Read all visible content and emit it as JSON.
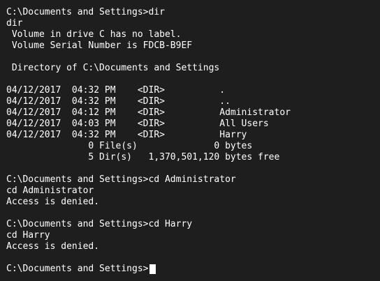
{
  "terminal": {
    "lines": [
      "C:\\Documents and Settings>dir",
      "dir",
      " Volume in drive C has no label.",
      " Volume Serial Number is FDCB-B9EF",
      "",
      " Directory of C:\\Documents and Settings",
      "",
      "04/12/2017  04:32 PM    <DIR>          .",
      "04/12/2017  04:32 PM    <DIR>          ..",
      "04/12/2017  04:12 PM    <DIR>          Administrator",
      "04/12/2017  04:03 PM    <DIR>          All Users",
      "04/12/2017  04:32 PM    <DIR>          Harry",
      "               0 File(s)              0 bytes",
      "               5 Dir(s)   1,370,501,120 bytes free",
      "",
      "C:\\Documents and Settings>cd Administrator",
      "cd Administrator",
      "Access is denied.",
      "",
      "C:\\Documents and Settings>cd Harry",
      "cd Harry",
      "Access is denied.",
      ""
    ],
    "prompt": "C:\\Documents and Settings>"
  }
}
